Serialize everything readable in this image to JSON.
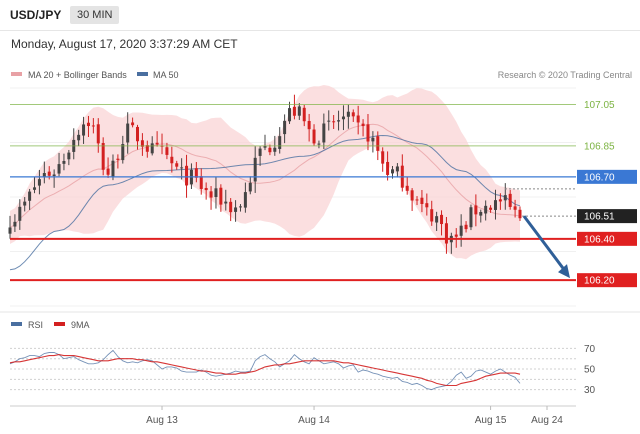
{
  "header": {
    "symbol": "USD/JPY",
    "timeframe": "30 MIN",
    "timestamp": "Monday, August 17, 2020 3:37:29 AM CET"
  },
  "legend": {
    "ma20": "MA 20 + Bollinger Bands",
    "ma50": "MA 50",
    "research": "Research © 2020 Trading Central"
  },
  "colors": {
    "bollinger": "#fad4d6",
    "ma20": "#e8a1a5",
    "ma50": "#4a6fa0",
    "resistance": "#7cb342",
    "pivot": "#3a78d4",
    "support": "#e02020",
    "arrow": "#2f5f98",
    "up_candle": "#444444",
    "down_candle": "#d32020",
    "rsi": "#4a6fa0",
    "rsi_ma": "#d32020"
  },
  "chart_data": [
    {
      "type": "candlestick",
      "y_range": [
        106.075,
        107.13
      ],
      "x_range": [
        0,
        104
      ],
      "x_ticks": [
        {
          "x": 31,
          "label": "Aug 13"
        },
        {
          "x": 62,
          "label": "Aug 14"
        },
        {
          "x": 98,
          "label": "Aug 15"
        },
        {
          "x": 109,
          "label": "Aug 24"
        }
      ],
      "levels": [
        {
          "value": 107.05,
          "label": "107.05",
          "kind": "resistance"
        },
        {
          "value": 106.85,
          "label": "106.85",
          "kind": "resistance"
        },
        {
          "value": 106.7,
          "label": "106.70",
          "kind": "pivot"
        },
        {
          "value": 106.51,
          "label": "106.51",
          "kind": "current"
        },
        {
          "value": 106.4,
          "label": "106.40",
          "kind": "support"
        },
        {
          "value": 106.2,
          "label": "106.20",
          "kind": "support"
        }
      ],
      "ma50_key": [
        [
          0,
          106.25
        ],
        [
          10,
          106.44
        ],
        [
          20,
          106.66
        ],
        [
          30,
          106.73
        ],
        [
          40,
          106.74
        ],
        [
          50,
          106.76
        ],
        [
          60,
          106.8
        ],
        [
          70,
          106.88
        ],
        [
          76,
          106.9
        ],
        [
          84,
          106.86
        ],
        [
          92,
          106.73
        ],
        [
          100,
          106.61
        ],
        [
          104,
          106.56
        ]
      ],
      "close_key": [
        [
          0,
          106.5
        ],
        [
          8,
          106.72
        ],
        [
          16,
          106.97
        ],
        [
          20,
          106.72
        ],
        [
          24,
          106.92
        ],
        [
          30,
          106.82
        ],
        [
          36,
          106.7
        ],
        [
          42,
          106.6
        ],
        [
          46,
          106.55
        ],
        [
          52,
          106.84
        ],
        [
          58,
          107.02
        ],
        [
          62,
          106.9
        ],
        [
          68,
          106.98
        ],
        [
          72,
          106.92
        ],
        [
          78,
          106.72
        ],
        [
          86,
          106.52
        ],
        [
          90,
          106.4
        ],
        [
          96,
          106.55
        ],
        [
          100,
          106.58
        ],
        [
          104,
          106.51
        ]
      ]
    },
    {
      "type": "line",
      "title": "RSI",
      "series": [
        {
          "name": "RSI",
          "values": [
            55,
            57,
            60,
            61,
            63,
            63,
            62,
            65,
            66,
            66,
            64,
            60,
            61,
            62,
            59,
            57,
            55,
            55,
            56,
            59,
            64,
            68,
            62,
            58,
            56,
            57,
            56,
            58,
            59,
            58,
            54,
            50,
            52,
            52,
            51,
            48,
            47,
            47,
            47,
            49,
            47,
            44,
            43,
            44,
            45,
            46,
            48,
            47,
            47,
            48,
            58,
            62,
            64,
            60,
            57,
            52,
            55,
            58,
            64,
            60,
            57,
            55,
            61,
            58,
            55,
            56,
            57,
            55,
            51,
            53,
            54,
            47,
            49,
            48,
            46,
            45,
            43,
            42,
            41,
            42,
            38,
            37,
            35,
            36,
            34,
            31,
            30,
            32,
            33,
            34,
            38,
            44,
            47,
            41,
            43,
            48,
            49,
            47,
            45,
            48,
            50,
            47,
            44,
            42,
            36
          ]
        },
        {
          "name": "9MA",
          "values": [
            56,
            57,
            57,
            58,
            59,
            60,
            61,
            62,
            63,
            63,
            64,
            63,
            63,
            63,
            62,
            61,
            60,
            59,
            58,
            58,
            58,
            59,
            60,
            60,
            60,
            60,
            59,
            59,
            58,
            57,
            57,
            56,
            55,
            54,
            53,
            52,
            51,
            50,
            49,
            48,
            48,
            47,
            46,
            46,
            45,
            45,
            45,
            46,
            46,
            47,
            48,
            50,
            52,
            53,
            54,
            54,
            55,
            55,
            56,
            57,
            58,
            58,
            58,
            58,
            58,
            58,
            58,
            57,
            56,
            56,
            55,
            54,
            53,
            52,
            51,
            50,
            49,
            48,
            47,
            46,
            45,
            44,
            43,
            42,
            41,
            39,
            38,
            36,
            35,
            34,
            34,
            34,
            36,
            37,
            38,
            39,
            41,
            43,
            44,
            45,
            46,
            46,
            46,
            46,
            45
          ]
        }
      ],
      "y_range": [
        18,
        82
      ],
      "y_ticks": [
        30,
        50,
        70
      ],
      "guides": [
        30,
        40,
        50,
        60,
        70
      ]
    }
  ]
}
